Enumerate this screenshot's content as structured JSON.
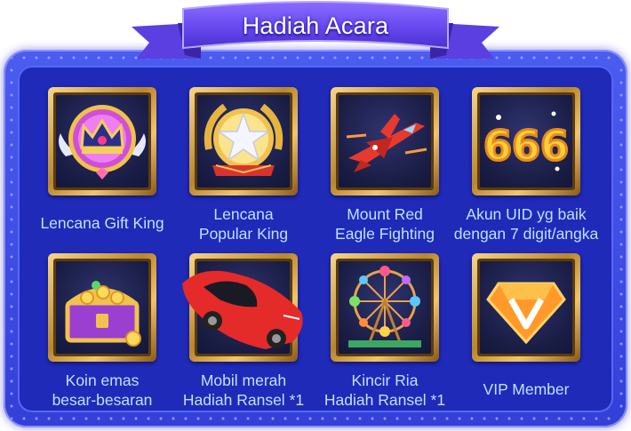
{
  "title": "Hadiah Acara",
  "rewards": [
    {
      "line1": "Lencana Gift King",
      "line2": "",
      "icon": "crown-badge-icon"
    },
    {
      "line1": "Lencana",
      "line2": "Popular King",
      "icon": "star-badge-icon"
    },
    {
      "line1": "Mount Red",
      "line2": "Eagle Fighting",
      "icon": "jet-mount-icon"
    },
    {
      "line1": "Akun UID yg baik",
      "line2": "dengan 7 digit/angka",
      "icon": "uid-666-icon"
    },
    {
      "line1": "Koin emas",
      "line2": "besar-besaran",
      "icon": "treasure-chest-icon"
    },
    {
      "line1": "Mobil merah",
      "line2": "Hadiah Ransel *1",
      "icon": "red-car-icon"
    },
    {
      "line1": "Kincir Ria",
      "line2": "Hadiah Ransel *1",
      "icon": "ferris-wheel-icon"
    },
    {
      "line1": "VIP Member",
      "line2": "",
      "icon": "vip-diamond-icon"
    }
  ]
}
